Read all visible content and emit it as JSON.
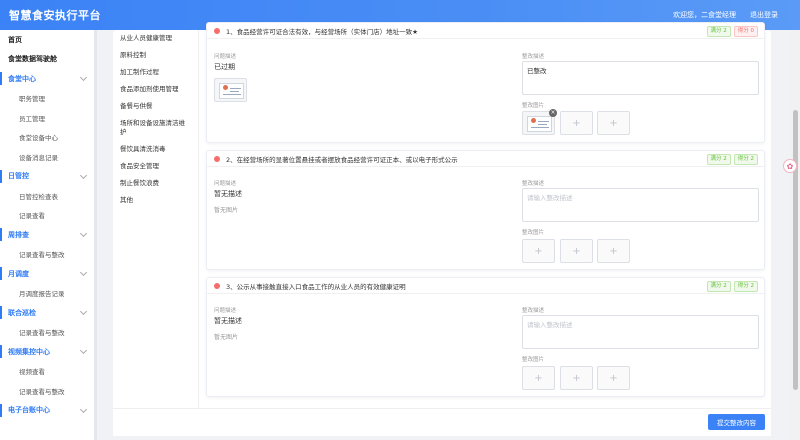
{
  "header": {
    "title": "智慧食安执行平台",
    "welcome": "欢迎您，二食堂经理",
    "logout": "退出登录"
  },
  "sidebar": {
    "items": [
      {
        "label": "首页",
        "kind": "bold"
      },
      {
        "label": "食堂数据驾驶舱",
        "kind": "bold"
      },
      {
        "label": "食堂中心",
        "kind": "group"
      },
      {
        "label": "职务管理",
        "kind": "sub"
      },
      {
        "label": "员工管理",
        "kind": "sub"
      },
      {
        "label": "食堂设备中心",
        "kind": "sub"
      },
      {
        "label": "设备消息记录",
        "kind": "sub"
      },
      {
        "label": "日管控",
        "kind": "group"
      },
      {
        "label": "日管控检查表",
        "kind": "sub"
      },
      {
        "label": "记录查看",
        "kind": "sub"
      },
      {
        "label": "周排查",
        "kind": "group"
      },
      {
        "label": "记录查看与整改",
        "kind": "sub"
      },
      {
        "label": "月调度",
        "kind": "group"
      },
      {
        "label": "月调度报告记录",
        "kind": "sub"
      },
      {
        "label": "联合巡检",
        "kind": "group"
      },
      {
        "label": "记录查看与整改",
        "kind": "sub"
      },
      {
        "label": "视频集控中心",
        "kind": "group"
      },
      {
        "label": "视频查看",
        "kind": "sub"
      },
      {
        "label": "记录查看与整改",
        "kind": "sub"
      },
      {
        "label": "电子台账中心",
        "kind": "group"
      }
    ]
  },
  "categories": [
    "从业人员健康管理",
    "原料控制",
    "加工制作过程",
    "食品添加剂使用管理",
    "备餐与供餐",
    "场所和设备设施清洁维护",
    "餐饮具清洗消毒",
    "食品安全管理",
    "制止餐饮浪费",
    "其他"
  ],
  "cards": [
    {
      "question": "1、食品经营许可证合法有效，与经营场所（实体门店）地址一致★",
      "badge_full": "满分 2",
      "badge_score": "得分 0",
      "problem_label": "问题描述",
      "problem_value": "已过期",
      "fix_label": "整改描述",
      "fix_value": "已整改",
      "fix_image_label": "整改图片"
    },
    {
      "question": "2、在经营场所的显著位置悬挂或者摆放食品经营许可证正本、或以电子形式公示",
      "badge_full": "满分 2",
      "badge_score": "得分 2",
      "problem_label": "问题描述",
      "problem_value": "暂无描述",
      "problem_image": "暂无图片",
      "fix_label": "整改描述",
      "fix_placeholder": "请输入整改描述",
      "fix_image_label": "整改图片"
    },
    {
      "question": "3、公示从事接触直接入口食品工作的从业人员的有效健康证明",
      "badge_full": "满分 2",
      "badge_score": "得分 2",
      "problem_label": "问题描述",
      "problem_value": "暂无描述",
      "problem_image": "暂无图片",
      "fix_label": "整改描述",
      "fix_placeholder": "请输入整改描述",
      "fix_image_label": "整改图片"
    }
  ],
  "submit_label": "提交整改内容",
  "icons": {
    "upload": "plus-icon",
    "remove": "close-icon",
    "float": "assistant-icon"
  },
  "colors": {
    "primary": "#3b82f6",
    "danger": "#f56c6c",
    "success": "#67c23a"
  }
}
